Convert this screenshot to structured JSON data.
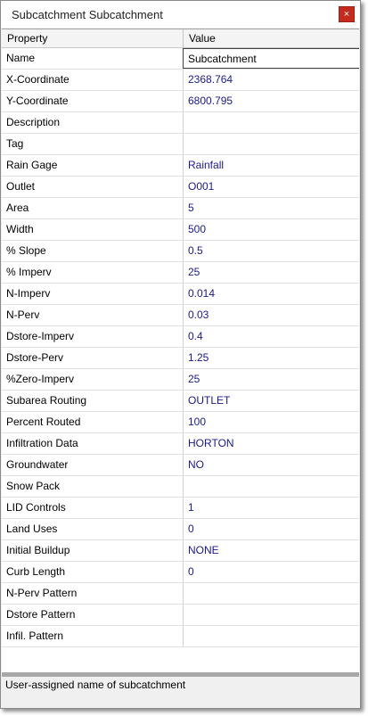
{
  "window": {
    "title": "Subcatchment Subcatchment",
    "close_label": "×"
  },
  "grid": {
    "columns": {
      "property": "Property",
      "value": "Value"
    },
    "rows": [
      {
        "property": "Name",
        "value": "Subcatchment"
      },
      {
        "property": "X-Coordinate",
        "value": "2368.764"
      },
      {
        "property": "Y-Coordinate",
        "value": "6800.795"
      },
      {
        "property": "Description",
        "value": ""
      },
      {
        "property": "Tag",
        "value": ""
      },
      {
        "property": "Rain Gage",
        "value": "Rainfall"
      },
      {
        "property": "Outlet",
        "value": "O001"
      },
      {
        "property": "Area",
        "value": "5"
      },
      {
        "property": "Width",
        "value": "500"
      },
      {
        "property": "% Slope",
        "value": "0.5"
      },
      {
        "property": "% Imperv",
        "value": "25"
      },
      {
        "property": "N-Imperv",
        "value": "0.014"
      },
      {
        "property": "N-Perv",
        "value": "0.03"
      },
      {
        "property": "Dstore-Imperv",
        "value": "0.4"
      },
      {
        "property": "Dstore-Perv",
        "value": "1.25"
      },
      {
        "property": "%Zero-Imperv",
        "value": "25"
      },
      {
        "property": "Subarea Routing",
        "value": "OUTLET"
      },
      {
        "property": "Percent Routed",
        "value": "100"
      },
      {
        "property": "Infiltration Data",
        "value": "HORTON"
      },
      {
        "property": "Groundwater",
        "value": "NO"
      },
      {
        "property": "Snow Pack",
        "value": ""
      },
      {
        "property": "LID Controls",
        "value": "1"
      },
      {
        "property": "Land Uses",
        "value": "0"
      },
      {
        "property": "Initial Buildup",
        "value": "NONE"
      },
      {
        "property": "Curb Length",
        "value": "0"
      },
      {
        "property": "N-Perv Pattern",
        "value": ""
      },
      {
        "property": "Dstore Pattern",
        "value": ""
      },
      {
        "property": "Infil. Pattern",
        "value": ""
      }
    ]
  },
  "status": {
    "hint": "User-assigned name of subcatchment"
  }
}
